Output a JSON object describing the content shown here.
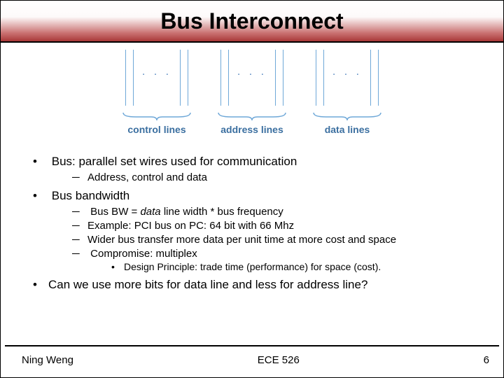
{
  "title": "Bus Interconnect",
  "diagram": {
    "groups": [
      {
        "label": "control lines"
      },
      {
        "label": "address lines"
      },
      {
        "label": "data lines"
      }
    ],
    "ellipsis": ". . ."
  },
  "bullets": {
    "b1": "Bus: parallel set wires used for communication",
    "b1_1": "Address, control  and data",
    "b2": "Bus bandwidth",
    "b2_1_pre": "Bus BW = ",
    "b2_1_ital": "data",
    "b2_1_post": " line width * bus frequency",
    "b2_2": "Example: PCI bus on PC: 64 bit with 66 Mhz",
    "b2_3": "Wider bus transfer more data per unit time at more cost and space",
    "b2_4": "Compromise: multiplex",
    "b2_4_1": "Design Principle: trade time (performance) for space (cost).",
    "b3": "Can we use more bits for data line and less for address line?"
  },
  "footer": {
    "left": "Ning Weng",
    "center": "ECE 526",
    "right": "6"
  }
}
